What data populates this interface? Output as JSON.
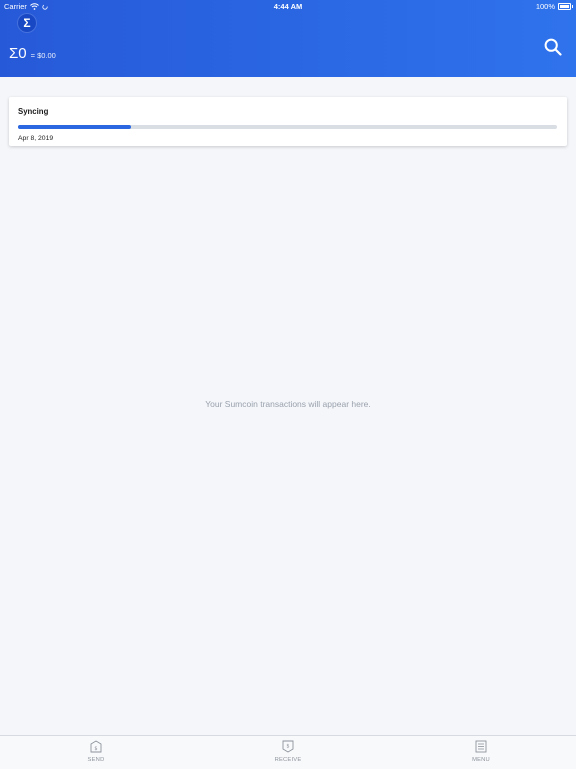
{
  "status_bar": {
    "carrier": "Carrier",
    "time": "4:44 AM",
    "battery": "100%"
  },
  "header": {
    "logo": "Σ",
    "balance": "Σ0",
    "fiat": "= $0.00",
    "search_icon": "search-icon"
  },
  "sync": {
    "title": "Syncing",
    "date": "Apr 8, 2019",
    "progress_percent": 21
  },
  "empty_state": {
    "message": "Your Sumcoin transactions will appear here."
  },
  "tabbar": {
    "send": {
      "label": "SEND",
      "icon": "send-icon"
    },
    "receive": {
      "label": "RECEIVE",
      "icon": "receive-icon"
    },
    "menu": {
      "label": "MENU",
      "icon": "menu-icon"
    }
  },
  "colors": {
    "header_start": "#2659d8",
    "header_end": "#2f73ec",
    "progress_fill": "#2a67e0",
    "background": "#f4f6fa"
  }
}
